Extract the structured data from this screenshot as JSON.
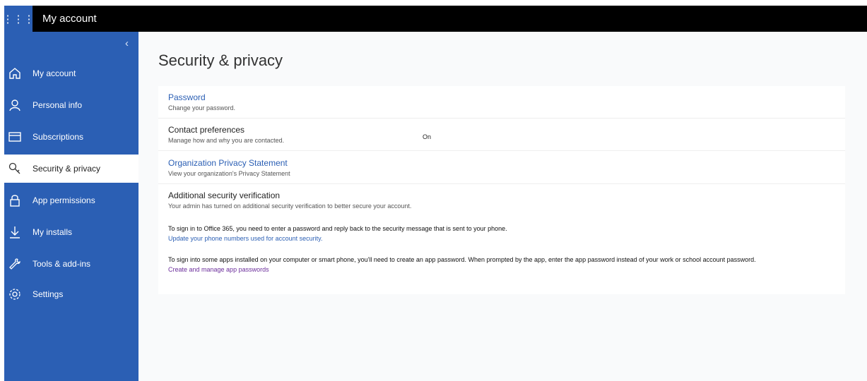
{
  "topbar": {
    "title": "My account",
    "waffle_glyph": "⋮⋮⋮"
  },
  "sidebar": {
    "collapse_glyph": "‹",
    "items": [
      {
        "label": "My account",
        "icon": "home-icon"
      },
      {
        "label": "Personal info",
        "icon": "person-icon"
      },
      {
        "label": "Subscriptions",
        "icon": "card-icon"
      },
      {
        "label": "Security & privacy",
        "icon": "key-icon",
        "active": true
      },
      {
        "label": "App permissions",
        "icon": "lock-icon"
      },
      {
        "label": "My installs",
        "icon": "download-icon"
      },
      {
        "label": "Tools & add-ins",
        "icon": "wrench-icon"
      },
      {
        "label": "Settings",
        "icon": "gear-icon"
      }
    ]
  },
  "main": {
    "title": "Security & privacy",
    "password": {
      "title": "Password",
      "subtitle": "Change your password."
    },
    "contact": {
      "title": "Contact preferences",
      "subtitle": "Manage how and why you are contacted.",
      "status": "On"
    },
    "privacy": {
      "title": "Organization Privacy Statement",
      "subtitle": "View your organization's Privacy Statement"
    },
    "verification": {
      "title": "Additional security verification",
      "subtitle": "Your admin has turned on additional security verification to better secure your account.",
      "text1": "To sign in to Office 365, you need to enter a password and reply back to the security message that is sent to your phone.",
      "link1": "Update your phone numbers used for account security.",
      "text2": "To sign into some apps installed on your computer or smart phone, you'll need to create an app password. When prompted by the app, enter the app password instead of your work or school account password.",
      "link2": "Create and manage app passwords"
    }
  },
  "colors": {
    "accent": "#2b5fb4",
    "link_purple": "#6b2e9b",
    "topbar": "#000000"
  }
}
